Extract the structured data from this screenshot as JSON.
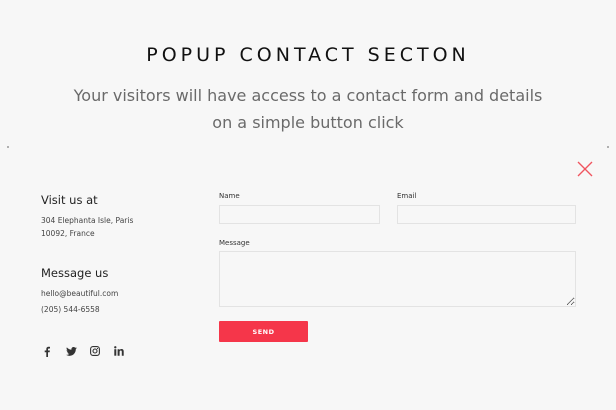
{
  "hero": {
    "title": "POPUP CONTACT SECTON",
    "subtitle_line1": "Your visitors will have access to a contact form and details",
    "subtitle_line2": "on a simple button click"
  },
  "popup": {
    "close_icon": "close-x-icon",
    "info": {
      "visit_title": "Visit us at",
      "address_line1": "304 Elephanta Isle, Paris",
      "address_line2": "10092, France",
      "message_title": "Message us",
      "email": "hello@beautiful.com",
      "phone": "(205) 544-6558"
    },
    "socials": [
      {
        "icon": "facebook-icon"
      },
      {
        "icon": "twitter-icon"
      },
      {
        "icon": "instagram-icon"
      },
      {
        "icon": "linkedin-icon"
      }
    ],
    "form": {
      "name_label": "Name",
      "name_value": "",
      "email_label": "Email",
      "email_value": "",
      "message_label": "Message",
      "message_value": "",
      "send_label": "SEND"
    }
  },
  "colors": {
    "accent": "#f5364a",
    "background": "#f7f7f7",
    "close_icon": "#f0545f"
  }
}
